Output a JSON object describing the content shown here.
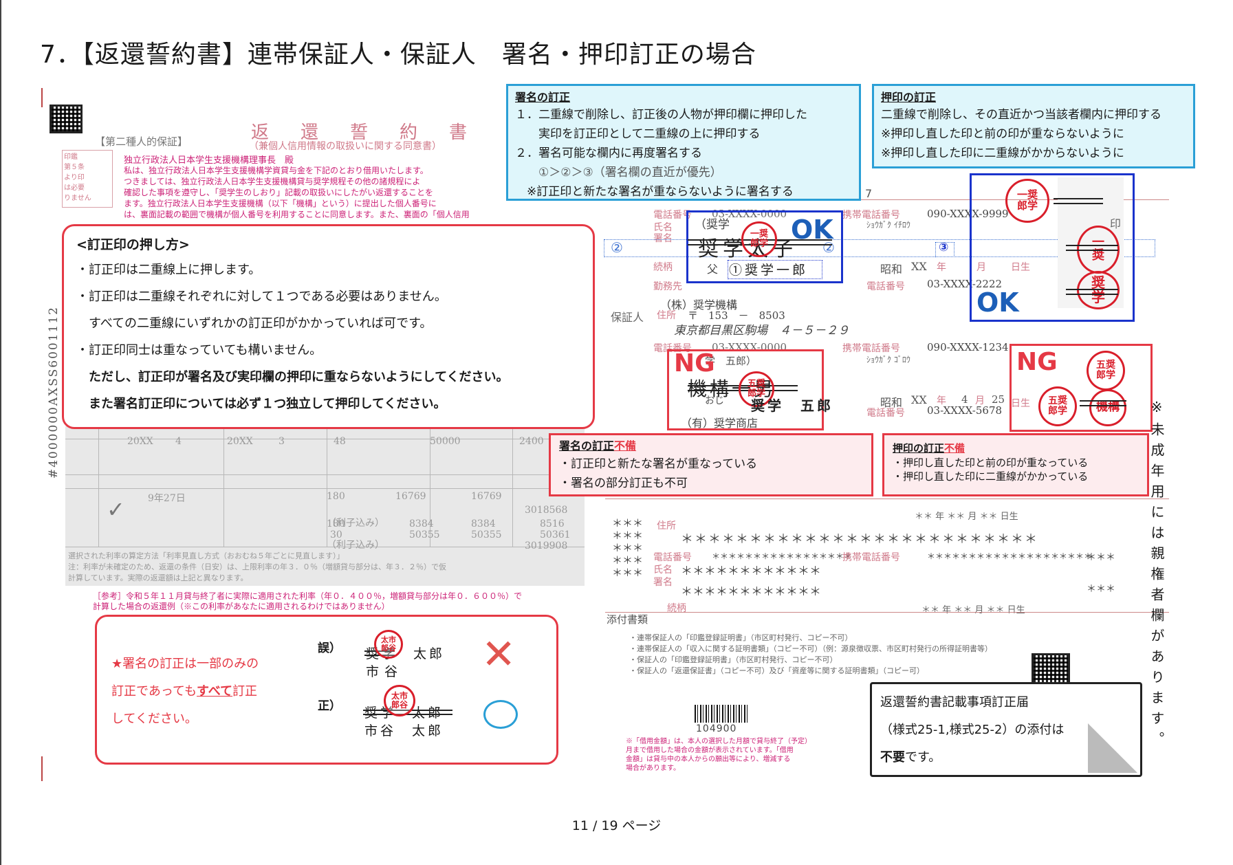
{
  "page": {
    "title": "7．【返還誓約書】連帯保証人・保証人　署名・押印訂正の場合",
    "footer": "11 / 19 ページ",
    "vertical_note": "※未成年用には親権者欄があります。"
  },
  "form": {
    "doc_title": "返　還　誓　約　書",
    "doc_subtitle": "（兼個人信用情報の取扱いに関する同意書）",
    "category": "【第二種人的保証】",
    "addressee": "独立行政法人日本学生支援機構理事長　殿",
    "intro_lines": [
      "私は、独立行政法人日本学生支援機構学資貸与金を下記のとおり借用いたします。",
      "つきましては、独立行政法人日本学生支援機構貸与奨学規程その他の諸規程によ",
      "確認した事項を遵守し、「奨学生のしおり」記載の取扱いにしたがい返還することを",
      "ます。独立行政法人日本学生支援機構（以下「機構」という）に提出した個人番号に",
      "は、裏面記載の範囲で機構が個人番号を利用することに同意します。また、裏面の「個人信用"
    ],
    "side_stamp": [
      "印鑑",
      "第５条",
      "より印",
      "は必要",
      "りません"
    ],
    "vertical_id": "#4000000AXSS6001112",
    "phone_label": "電話番号",
    "mobile_label": "携帯電話番号",
    "name_label": "氏名",
    "sign_label": "署名",
    "relation_label": "続柄",
    "workplace_label": "勤務先",
    "address_label": "住所",
    "phone1": "03-XXXX-0000",
    "mobile1": "090-XXXX-9999",
    "furigana1": "ｼｮｳｶﾞｸ ｲﾁﾛｳ",
    "signed_name_struck": "奨学太子",
    "relation1": "父",
    "corrected_name": "①奨学一郎",
    "era": "昭和",
    "era_year": "XX",
    "year_label": "年",
    "month_label": "月",
    "day_label": "日生",
    "work_phone1": "03-XXXX-2222",
    "guarantor_label": "保証人",
    "company1": "（株）奨学機構",
    "postal": "〒　153　－　8503",
    "address": "東京都目黒区駒場　４－５－２９",
    "phone2": "03-XXXX-0000",
    "mobile2": "090-XXXX-1234",
    "furigana2": "ｼｮｳｶﾞｸ ｺﾞﾛｳ",
    "name2_top": "学　五郎）",
    "signed_name2_struck": "機構一男",
    "relation2": "おじ",
    "name2_correct": "奨学　五郎",
    "birth2_month": "4",
    "birth2_day": "25",
    "work_phone2": "03-XXXX-5678",
    "company2": "（有）奨学商店",
    "stars_row": "＊＊＊＊＊＊＊＊＊＊＊＊＊＊＊＊＊＊＊＊＊＊＊＊＊＊",
    "stars_name": "＊＊＊＊＊＊＊＊＊＊＊＊",
    "stars_phone": "＊＊＊＊＊＊＊＊＊＊＊＊＊＊＊＊＊",
    "stars_mobile": "＊＊＊＊＊＊＊＊＊＊＊＊＊＊＊＊＊＊＊＊",
    "stars_short": "＊＊＊",
    "stars_date": "＊＊ 年 ＊＊ 月 ＊＊ 日生",
    "attachments_label": "添付書類",
    "attachments": [
      "・連帯保証人の「印鑑登録証明書」（市区町村発行、コピー不可）",
      "・連帯保証人の「収入に関する証明書類」（コピー不可）（例：源泉徴収票、市区町村発行の所得証明書等）",
      "・保証人の「印鑑登録証明書」（市区町村発行、コピー不可）",
      "・保証人の「返還保証書」（コピー不可）及び「資産等に関する証明書類」（コピー可）"
    ],
    "barcode_number": "104900",
    "note_lines": [
      "※「借用金額」は、本人の選択した月額で貸与終了（予定）",
      "月まで借用した場合の金額が表示されています。「借用",
      "金額」は貸与中の本人からの願出等により、増減する",
      "場合があります。"
    ],
    "ref_text_1": "［参考］令和５年１１月貸与終了者に実際に適用された利率（年０．４００％，増額貸与部分は年０．６００％）で",
    "ref_text_2": "計算した場合の返還例（※この利率があなたに適用されるわけではありません）",
    "table_values": [
      "20XX",
      "4",
      "20XX",
      "3",
      "48",
      "50000",
      "2400"
    ],
    "table_rows": [
      [
        "180",
        "16769",
        "16769",
        "3018568"
      ],
      [
        "180",
        "8384",
        "8384",
        "8516"
      ],
      [
        "30",
        "50355",
        "50355",
        "50361"
      ],
      [
        "",
        "",
        "",
        "3019908"
      ]
    ],
    "rate_note_1": "選択された利率の算定方法「利率見直し方式（おおむね５年ごとに見直します）」",
    "rate_note_2": "注：利率が未確定のため、返還の条件（日安）は、上限利率の年３．０％（増額貸与部分は、年３．２％）で仮",
    "rate_note_3": "計算しています。実際の返還額は上記と異なります。",
    "interest_label": "（利子込み）",
    "date_label": "9年27日"
  },
  "callouts": {
    "sign_fix": {
      "heading": "署名の訂正",
      "lines": [
        "１．二重線で削除し、訂正後の人物が押印欄に押印した",
        "　　実印を訂正印として二重線の上に押印する",
        "２．署名可能な欄内に再度署名する",
        "　　①＞②＞③（署名欄の直近が優先）",
        "　※訂正印と新たな署名が重ならないように署名する"
      ]
    },
    "seal_fix": {
      "heading": "押印の訂正",
      "lines": [
        "二重線で削除し、その直近かつ当該者欄内に押印する",
        "※押印し直した印と前の印が重ならないように",
        "※押印し直した印に二重線がかからないように"
      ]
    },
    "how_to": {
      "heading": "<訂正印の押し方>",
      "lines": [
        "・訂正印は二重線上に押します。",
        "・訂正印は二重線それぞれに対して１つである必要はありません。",
        "　すべての二重線にいずれかの訂正印がかかっていれば可です。",
        "・訂正印同士は重なっていても構いません。",
        "　ただし、訂正印が署名及び実印欄の押印に重ならないようにしてください。",
        "　また署名訂正印については必ず１つ独立して押印してください。"
      ]
    },
    "sign_ng": {
      "heading_a": "署名の訂正",
      "heading_b": "不備",
      "lines": [
        "・訂正印と新たな署名が重なっている",
        "・署名の部分訂正も不可"
      ]
    },
    "seal_ng": {
      "heading_a": "押印の訂正",
      "heading_b": "不備",
      "lines": [
        "・押印し直した印と前の印が重なっている",
        "・押印し直した印に二重線がかかっている"
      ]
    },
    "partial": {
      "line1": "★署名の訂正は一部のみの",
      "line2a": "訂正であっても",
      "line2b": "すべて",
      "line2c": "訂正",
      "line3": "してください。",
      "wrong_label": "誤）",
      "right_label": "正）",
      "wrong_top": "奨学　太郎",
      "wrong_bottom": "市谷",
      "right_top": "奨学　太郎",
      "right_bottom": "市谷　太郎"
    },
    "attach_note": {
      "line1": "返還誓約書記載事項訂正届",
      "line2": "（様式25-1,様式25-2）の添付は",
      "line3a": "不要",
      "line3b": "です。"
    }
  },
  "marks": {
    "ok": "OK",
    "ng": "NG",
    "circle2": "②",
    "circle3": "③",
    "seal_ichiro": "一奨\n郎学",
    "seal_goro": "五奨\n郎学",
    "seal_taro": "太市\n郎谷",
    "seal_kiko": "機構",
    "seal_shogaku": "奨学",
    "seal_in": "印"
  },
  "colors": {
    "cyan_border": "#2a9fd6",
    "red": "#e53945",
    "blue": "#1a33cc",
    "ok_blue": "#1d5fb8"
  }
}
